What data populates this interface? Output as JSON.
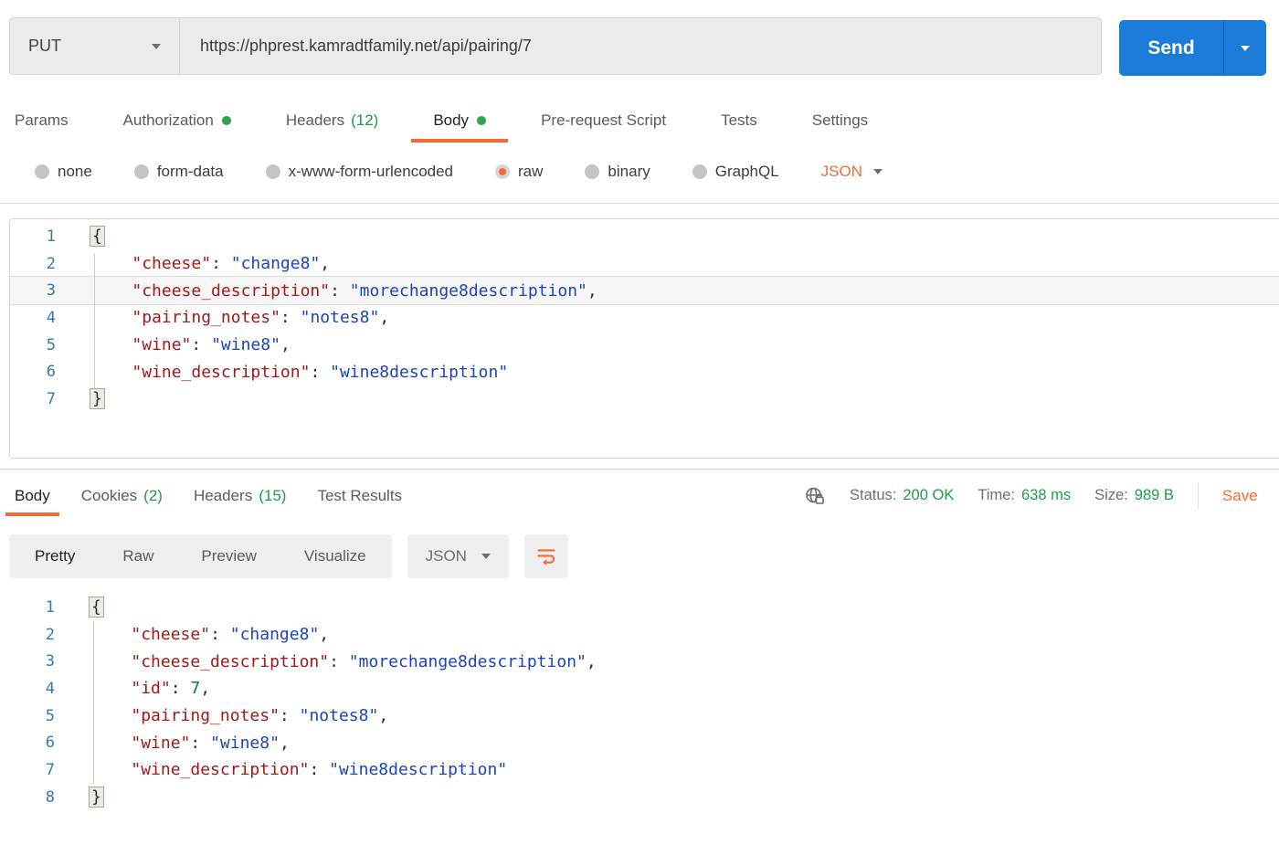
{
  "colors": {
    "accent": "#f26c37",
    "green": "#219a4c",
    "send-blue": "#1a7cd8",
    "key-red": "#a01a1a",
    "string-blue": "#1b44ba",
    "number-green": "#0f7d41",
    "line-number-blue": "#3579a8"
  },
  "request_bar": {
    "method": "PUT",
    "url": "https://phprest.kamradtfamily.net/api/pairing/7",
    "send_label": "Send"
  },
  "request_tabs": [
    {
      "label": "Params"
    },
    {
      "label": "Authorization",
      "dot": true
    },
    {
      "label": "Headers",
      "count": "(12)"
    },
    {
      "label": "Body",
      "dot": true,
      "active": true
    },
    {
      "label": "Pre-request Script"
    },
    {
      "label": "Tests"
    },
    {
      "label": "Settings"
    }
  ],
  "body_type": {
    "options": [
      {
        "label": "none"
      },
      {
        "label": "form-data"
      },
      {
        "label": "x-www-form-urlencoded"
      },
      {
        "label": "raw",
        "selected": true
      },
      {
        "label": "binary"
      },
      {
        "label": "GraphQL"
      }
    ],
    "format": "JSON"
  },
  "request_editor": {
    "lines": [
      {
        "num": 1,
        "tokens": [
          {
            "c": "b",
            "v": "{"
          }
        ]
      },
      {
        "num": 2,
        "tokens": [
          {
            "c": "p",
            "v": "    "
          },
          {
            "c": "k",
            "v": "\"cheese\""
          },
          {
            "c": "p",
            "v": ": "
          },
          {
            "c": "s",
            "v": "\"change8\""
          },
          {
            "c": "p",
            "v": ","
          }
        ]
      },
      {
        "num": 3,
        "active": true,
        "tokens": [
          {
            "c": "p",
            "v": "    "
          },
          {
            "c": "k",
            "v": "\"cheese_description\""
          },
          {
            "c": "p",
            "v": ": "
          },
          {
            "c": "s",
            "v": "\"morechange8description\""
          },
          {
            "c": "p",
            "v": ","
          }
        ]
      },
      {
        "num": 4,
        "tokens": [
          {
            "c": "p",
            "v": "    "
          },
          {
            "c": "k",
            "v": "\"pairing_notes\""
          },
          {
            "c": "p",
            "v": ": "
          },
          {
            "c": "s",
            "v": "\"notes8\""
          },
          {
            "c": "p",
            "v": ","
          }
        ]
      },
      {
        "num": 5,
        "tokens": [
          {
            "c": "p",
            "v": "    "
          },
          {
            "c": "k",
            "v": "\"wine\""
          },
          {
            "c": "p",
            "v": ": "
          },
          {
            "c": "s",
            "v": "\"wine8\""
          },
          {
            "c": "p",
            "v": ","
          }
        ]
      },
      {
        "num": 6,
        "tokens": [
          {
            "c": "p",
            "v": "    "
          },
          {
            "c": "k",
            "v": "\"wine_description\""
          },
          {
            "c": "p",
            "v": ": "
          },
          {
            "c": "s",
            "v": "\"wine8description\""
          }
        ]
      },
      {
        "num": 7,
        "tokens": [
          {
            "c": "b",
            "v": "}"
          }
        ]
      }
    ]
  },
  "response_tabs": [
    {
      "label": "Body",
      "active": true
    },
    {
      "label": "Cookies",
      "count": "(2)"
    },
    {
      "label": "Headers",
      "count": "(15)"
    },
    {
      "label": "Test Results"
    }
  ],
  "response_meta": {
    "status_label": "Status:",
    "status_value": "200 OK",
    "time_label": "Time:",
    "time_value": "638 ms",
    "size_label": "Size:",
    "size_value": "989 B",
    "save_label": "Save"
  },
  "response_toolbar": {
    "views": [
      {
        "label": "Pretty",
        "active": true
      },
      {
        "label": "Raw"
      },
      {
        "label": "Preview"
      },
      {
        "label": "Visualize"
      }
    ],
    "format": "JSON"
  },
  "response_editor": {
    "lines": [
      {
        "num": 1,
        "tokens": [
          {
            "c": "b",
            "v": "{"
          }
        ]
      },
      {
        "num": 2,
        "tokens": [
          {
            "c": "p",
            "v": "    "
          },
          {
            "c": "k",
            "v": "\"cheese\""
          },
          {
            "c": "p",
            "v": ": "
          },
          {
            "c": "s",
            "v": "\"change8\""
          },
          {
            "c": "p",
            "v": ","
          }
        ]
      },
      {
        "num": 3,
        "tokens": [
          {
            "c": "p",
            "v": "    "
          },
          {
            "c": "k",
            "v": "\"cheese_description\""
          },
          {
            "c": "p",
            "v": ": "
          },
          {
            "c": "s",
            "v": "\"morechange8description\""
          },
          {
            "c": "p",
            "v": ","
          }
        ]
      },
      {
        "num": 4,
        "tokens": [
          {
            "c": "p",
            "v": "    "
          },
          {
            "c": "k",
            "v": "\"id\""
          },
          {
            "c": "p",
            "v": ": "
          },
          {
            "c": "n",
            "v": "7"
          },
          {
            "c": "p",
            "v": ","
          }
        ]
      },
      {
        "num": 5,
        "tokens": [
          {
            "c": "p",
            "v": "    "
          },
          {
            "c": "k",
            "v": "\"pairing_notes\""
          },
          {
            "c": "p",
            "v": ": "
          },
          {
            "c": "s",
            "v": "\"notes8\""
          },
          {
            "c": "p",
            "v": ","
          }
        ]
      },
      {
        "num": 6,
        "tokens": [
          {
            "c": "p",
            "v": "    "
          },
          {
            "c": "k",
            "v": "\"wine\""
          },
          {
            "c": "p",
            "v": ": "
          },
          {
            "c": "s",
            "v": "\"wine8\""
          },
          {
            "c": "p",
            "v": ","
          }
        ]
      },
      {
        "num": 7,
        "tokens": [
          {
            "c": "p",
            "v": "    "
          },
          {
            "c": "k",
            "v": "\"wine_description\""
          },
          {
            "c": "p",
            "v": ": "
          },
          {
            "c": "s",
            "v": "\"wine8description\""
          }
        ]
      },
      {
        "num": 8,
        "tokens": [
          {
            "c": "b",
            "v": "}"
          }
        ]
      }
    ]
  }
}
